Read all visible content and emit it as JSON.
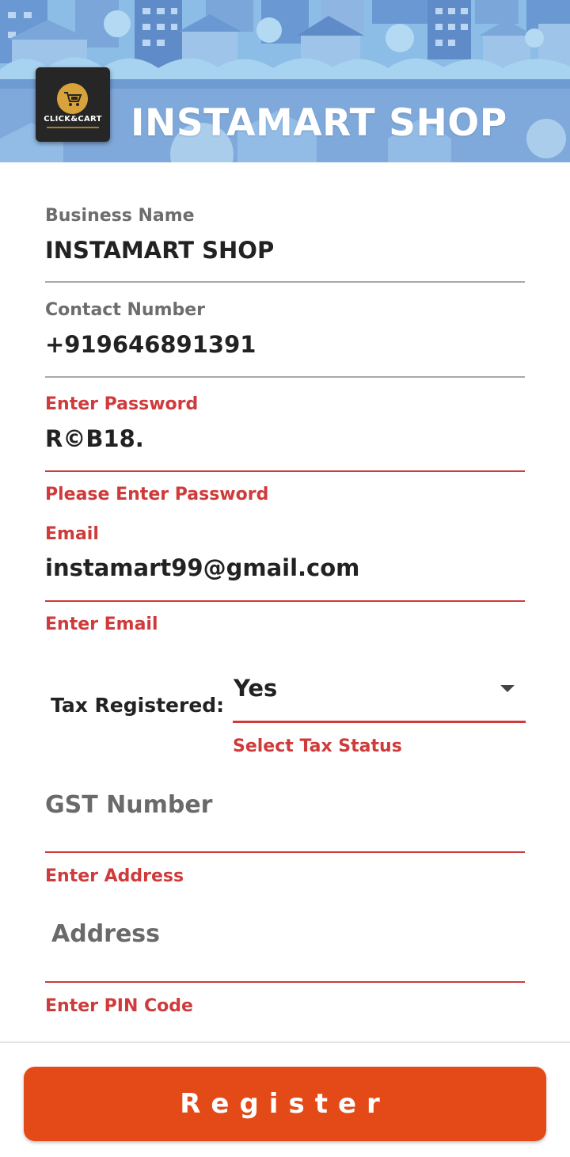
{
  "header": {
    "title": "INSTAMART SHOP",
    "logo_text": "CLICK&CART",
    "colors": {
      "sky": "#7fb2e0",
      "buildings": "#5a86c6",
      "trees": "#9fd1ef"
    }
  },
  "form": {
    "business_name": {
      "label": "Business Name",
      "value": "INSTAMART SHOP"
    },
    "contact_number": {
      "label": "Contact Number",
      "value": "+919646891391"
    },
    "password": {
      "label": "Enter Password",
      "value": "R©B18.",
      "error": "Please Enter Password"
    },
    "email": {
      "label": "Email",
      "value": "instamart99@gmail.com",
      "error": "Enter Email"
    },
    "tax_registered": {
      "label": "Tax Registered:",
      "selected": "Yes",
      "error": "Select Tax Status"
    },
    "gst_number": {
      "placeholder": "GST Number",
      "error": "Enter Address"
    },
    "address": {
      "placeholder": "Address",
      "error": "Enter PIN Code"
    }
  },
  "register_button": {
    "label": "Register",
    "color": "#e44a18"
  },
  "colors": {
    "error": "#cf3a3a",
    "text": "#222222",
    "label": "#6d6d6d"
  }
}
